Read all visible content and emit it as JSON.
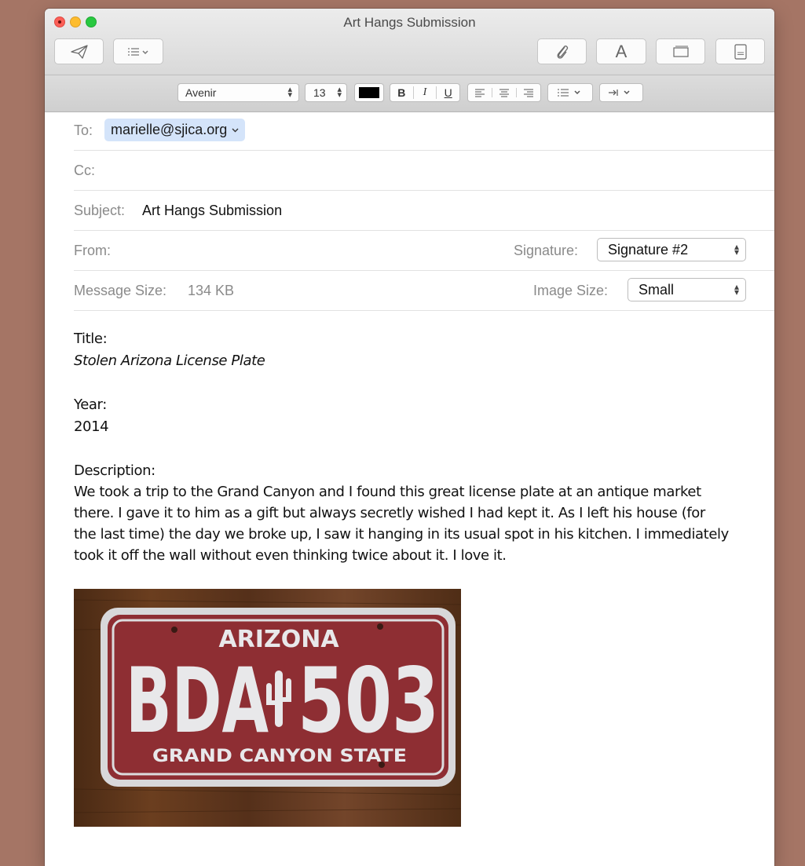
{
  "window": {
    "title": "Art Hangs Submission"
  },
  "format_bar": {
    "font_family": "Avenir",
    "font_size": "13",
    "color_swatch": "#000000",
    "bold_label": "B",
    "italic_label": "I",
    "underline_label": "U"
  },
  "headers": {
    "to_label": "To:",
    "to_value": "marielle@sjica.org",
    "cc_label": "Cc:",
    "subject_label": "Subject:",
    "subject_value": "Art Hangs Submission",
    "from_label": "From:",
    "signature_label": "Signature:",
    "signature_value": "Signature #2",
    "message_size_label": "Message Size:",
    "message_size_value": "134 KB",
    "image_size_label": "Image Size:",
    "image_size_value": "Small"
  },
  "body": {
    "title_label": "Title:",
    "title_value": "Stolen Arizona License Plate",
    "year_label": "Year:",
    "year_value": "2014",
    "description_label": "Description:",
    "description_lines": [
      "We took a trip to the Grand Canyon and I found this great license plate at an antique market",
      "there. I gave it to him as a gift but always secretly wished I had kept it. As I left his house (for",
      "the last time) the day we broke up, I saw it hanging in its usual spot in his kitchen. I immediately",
      "took it off the wall without even thinking twice about it. I love it."
    ]
  },
  "plate": {
    "state": "ARIZONA",
    "number_left": "BDA",
    "number_right": "503",
    "slogan": "GRAND CANYON STATE"
  },
  "colors": {
    "desktop": "#a57565",
    "recipient_token": "#d4e4fa",
    "plate_red": "#8e2e33",
    "plate_letters": "#e8e8ea"
  }
}
